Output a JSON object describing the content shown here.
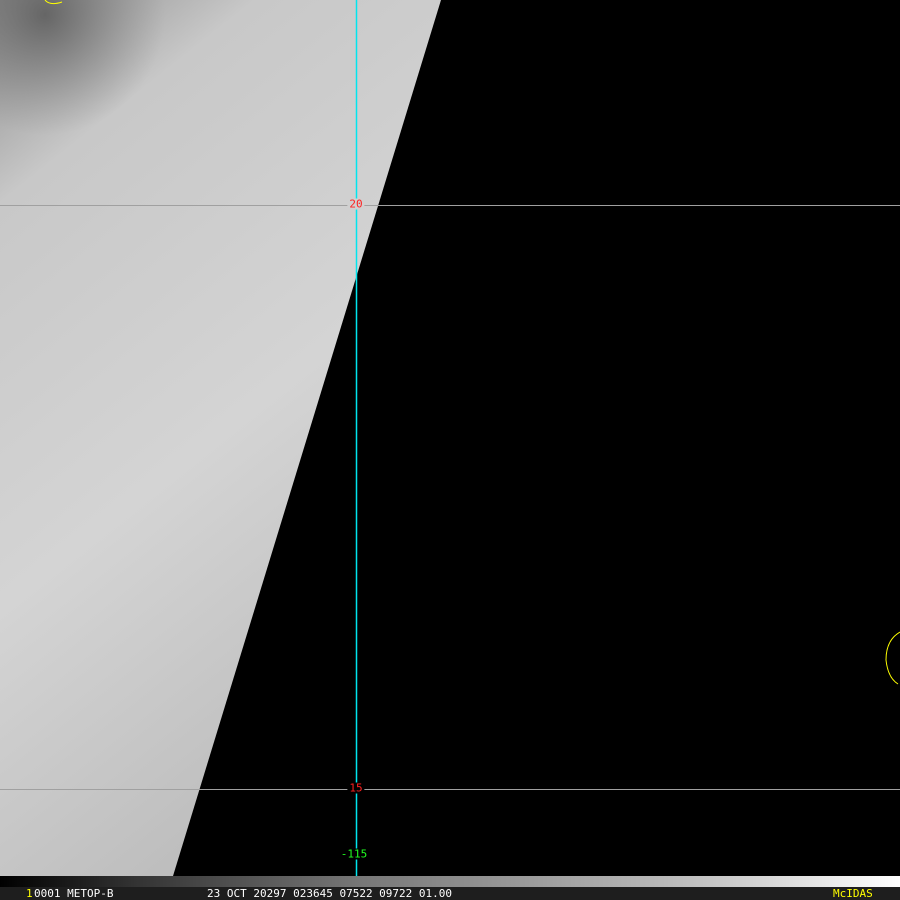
{
  "grid": {
    "lat_labels": [
      "20",
      "15"
    ],
    "lon_label": "-115",
    "lat_color": "#ff2020",
    "lon_color": "#20ff20",
    "meridian_color": "#00e5ee",
    "parallel_color": "#a0a0a0"
  },
  "infobar": {
    "frame": "1",
    "id": "0001 METOP-B",
    "datetime": "23 OCT 20297 023645 07522 09722 01.00",
    "brand": "McIDAS",
    "brand_color": "#ffff00"
  }
}
